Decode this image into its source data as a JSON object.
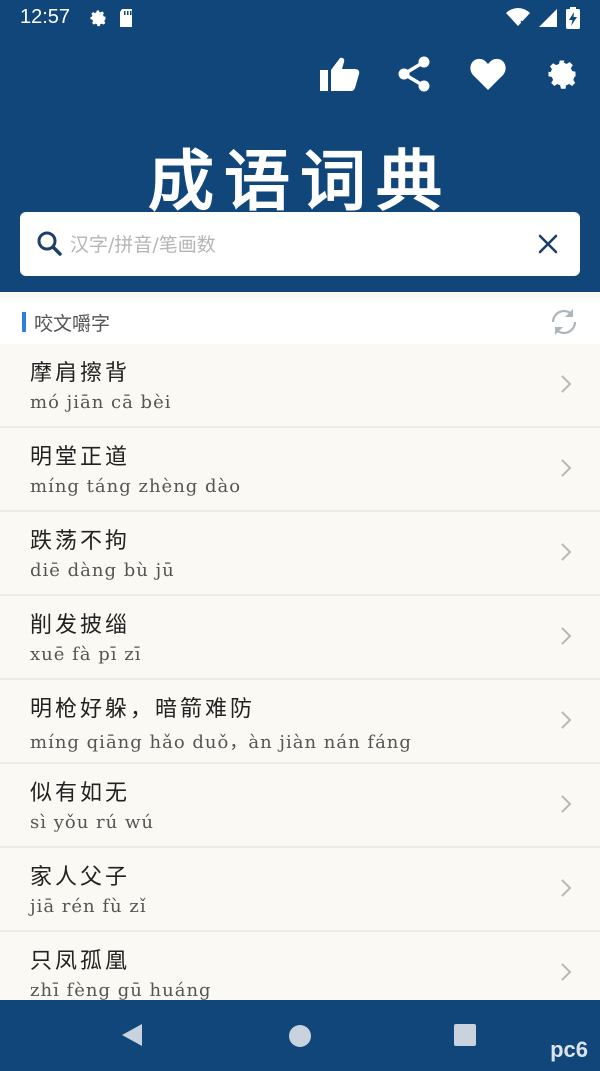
{
  "status_bar": {
    "time": "12:57",
    "left_icons": [
      "gear-icon",
      "sd-card-icon"
    ],
    "right_icons": [
      "wifi-icon",
      "signal-icon",
      "battery-charging-icon"
    ]
  },
  "toolbar": {
    "icons": [
      "thumbs-up-icon",
      "share-icon",
      "heart-icon",
      "gear-icon"
    ]
  },
  "app_title": "成语词典",
  "search": {
    "placeholder": "汉字/拼音/笔画数",
    "value": ""
  },
  "section": {
    "title": "咬文嚼字"
  },
  "idioms": [
    {
      "text": "摩肩擦背",
      "pinyin": "mó jiān cā bèi"
    },
    {
      "text": "明堂正道",
      "pinyin": "míng táng zhèng dào"
    },
    {
      "text": "跌荡不拘",
      "pinyin": "diē dàng bù jū"
    },
    {
      "text": "削发披缁",
      "pinyin": "xuē fà pī zī"
    },
    {
      "text": "明枪好躲，暗箭难防",
      "pinyin": "míng qiāng hǎo duǒ，àn jiàn nán fáng"
    },
    {
      "text": "似有如无",
      "pinyin": "sì yǒu rú wú"
    },
    {
      "text": "家人父子",
      "pinyin": "jiā rén fù zǐ"
    },
    {
      "text": "只凤孤凰",
      "pinyin": "zhī fèng gū huáng"
    }
  ],
  "nav": {
    "icons": [
      "back-icon",
      "home-icon",
      "recents-icon"
    ]
  },
  "watermark": "pc6",
  "colors": {
    "primary": "#11467a",
    "accent": "#2e7fd6",
    "background": "#fbf9f3"
  }
}
